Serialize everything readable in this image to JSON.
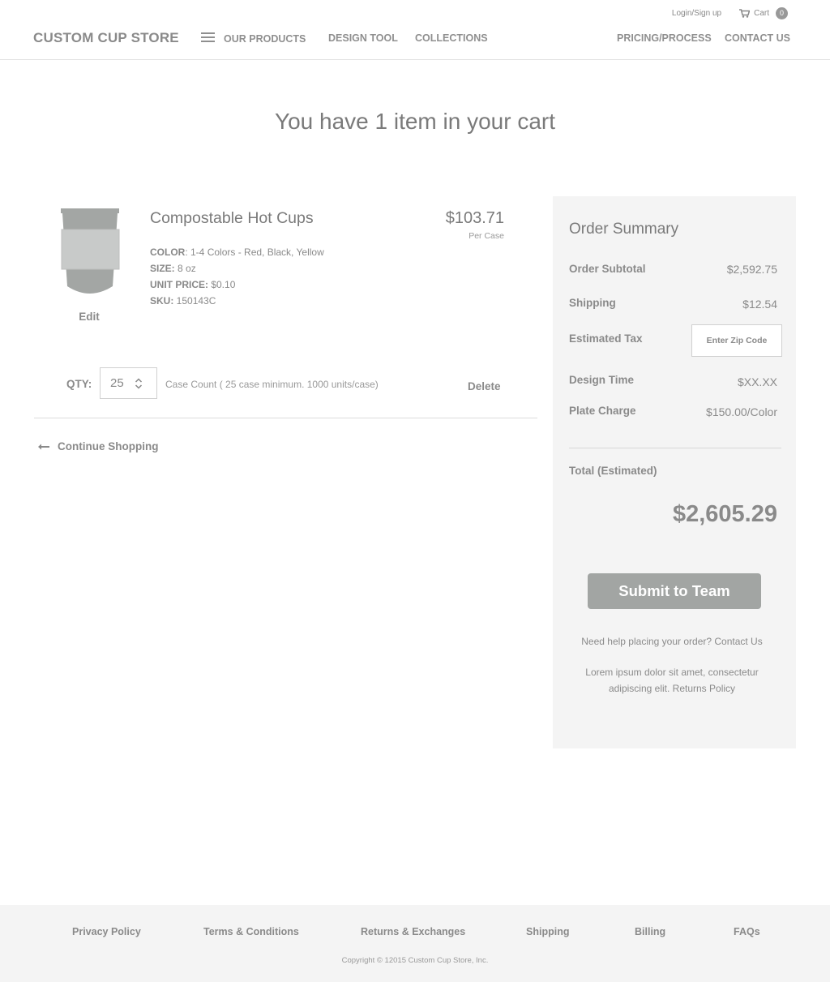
{
  "header": {
    "logo": "CUSTOM CUP STORE",
    "login": "Login/Sign up",
    "cart_label": "Cart",
    "cart_count": "0",
    "nav": {
      "products": "OUR PRODUCTS",
      "design_tool": "DESIGN TOOL",
      "collections": "COLLECTIONS",
      "pricing": "PRICING/PROCESS",
      "contact": "CONTACT US"
    }
  },
  "page": {
    "title": "You have 1 item in your cart"
  },
  "cart_item": {
    "name": "Compostable Hot Cups",
    "price": "$103.71",
    "price_unit": "Per Case",
    "edit": "Edit",
    "specs": {
      "color_label": "COLOR",
      "color_value": ": 1-4 Colors - Red, Black, Yellow",
      "size_label": "SIZE:",
      "size_value": " 8 oz",
      "unit_price_label": "UNIT PRICE:",
      "unit_price_value": " $0.10",
      "sku_label": "SKU:",
      "sku_value": " 150143C"
    },
    "qty_label": "QTY:",
    "qty_value": "25",
    "case_count": "Case Count ( 25 case minimum. 1000 units/case)",
    "delete": "Delete"
  },
  "continue_shopping": "Continue Shopping",
  "summary": {
    "title": "Order Summary",
    "subtotal_label": "Order Subtotal",
    "subtotal_value": "$2,592.75",
    "shipping_label": "Shipping",
    "shipping_value": "$12.54",
    "tax_label": "Estimated Tax",
    "zip_placeholder": "Enter Zip Code",
    "design_time_label": "Design Time",
    "design_time_value": "$XX.XX",
    "plate_charge_label": "Plate Charge",
    "plate_charge_value": "$150.00/Color",
    "total_label": "Total (Estimated)",
    "total_value": "$2,605.29",
    "submit": "Submit to Team",
    "help": "Need help placing your order? Contact Us",
    "lorem": "Lorem ipsum dolor sit amet, consectetur adipiscing elit. Returns Policy"
  },
  "footer": {
    "links": [
      "Privacy Policy",
      "Terms & Conditions",
      "Returns & Exchanges",
      "Shipping",
      "Billing",
      "FAQs"
    ],
    "copyright": "Copyright © 12015 Custom Cup Store, Inc."
  },
  "colors": {
    "text": "#7a7a7a",
    "summary_bg": "#f4f4f4",
    "button": "#a2a5a3",
    "cup": "#a3a6a4"
  }
}
